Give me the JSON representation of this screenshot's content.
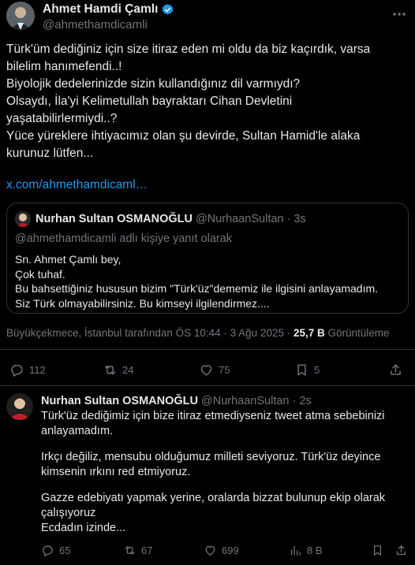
{
  "main_tweet": {
    "author_name": "Ahmet Hamdi Çamlı",
    "handle": "@ahmethamdicamli",
    "lines": [
      "Türk'üm dediğiniz için size itiraz eden mi oldu da biz kaçırdık, varsa",
      "bilelim hanımefendi..!",
      "Biyolojik dedelerinizde sizin kullandığınız dil varmıydı?",
      "Olsaydı, İla'yi Kelimetullah bayraktarı  Cihan Devletini",
      "yaşatabilirlermiydi..?",
      "Yüce yüreklere ihtiyacımız olan şu devirde, Sultan Hamid'le alaka",
      "kurunuz lütfen..."
    ],
    "link": "x.com/ahmethamdicaml…",
    "meta_location": "Büyükçekmece, İstanbul tarafından ÖS 10:44 · 3 Ağu 2025 · ",
    "meta_views_count": "25,7 B",
    "meta_views_label": " Görüntüleme",
    "actions": {
      "replies": "112",
      "retweets": "24",
      "likes": "75",
      "bookmarks": "5"
    }
  },
  "quoted_tweet": {
    "author_name": "Nurhan Sultan OSMANOĞLU",
    "handle": "@NurhaanSultan",
    "time": "· 3s",
    "reply_to": "@ahmethamdicamli adlı kişiye yanıt olarak",
    "lines": [
      "Sn. Ahmet Çamlı bey,",
      "Çok tuhaf.",
      "Bu bahsettiğiniz hususun bizim \"Türk'üz\"dememiz ile ilgisini anlayamadım.",
      "Siz Türk olmayabilirsiniz. Bu kimseyi ilgilendirmez...."
    ]
  },
  "reply_tweet": {
    "author_name": "Nurhan Sultan OSMANOĞLU",
    "handle": "@NurhaanSultan",
    "time": "· 2s",
    "lines": [
      "Türk'üz dediğimiz için bize itiraz etmediyseniz tweet atma sebebinizi",
      "anlayamadım.",
      "",
      "Irkçı değiliz, mensubu olduğumuz milleti seviyoruz. Türk'üz deyince",
      "kimsenin ırkını red etmiyoruz.",
      "",
      "Gazze edebiyatı yapmak yerine, oralarda bizzat bulunup ekip olarak",
      "çalışıyoruz",
      "Ecdadın izinde..."
    ],
    "actions": {
      "replies": "65",
      "retweets": "67",
      "likes": "699",
      "views": "8 B"
    }
  },
  "colors": {
    "accent": "#1d9bf0",
    "muted": "#71767b",
    "border": "#2f3336",
    "background": "#000000"
  }
}
